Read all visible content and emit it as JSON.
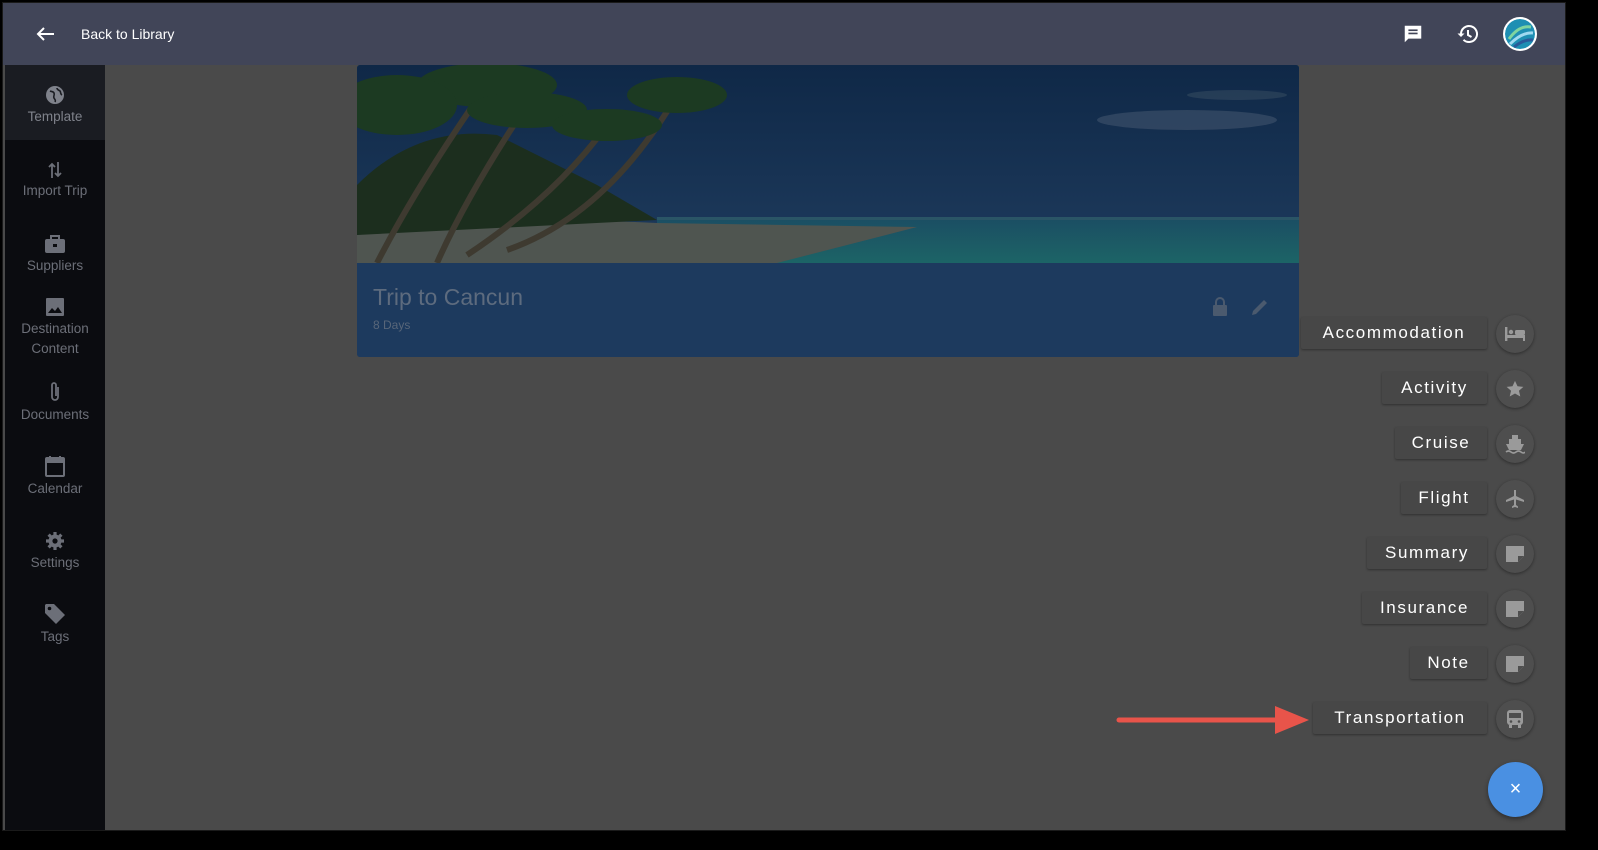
{
  "header": {
    "back_label": "Back to Library",
    "icons": [
      "arrow-back-icon",
      "chat-icon",
      "history-icon",
      "avatar"
    ]
  },
  "sidebar": {
    "items": [
      {
        "label": "Template",
        "icon": "globe-icon",
        "active": true
      },
      {
        "label": "Import Trip",
        "icon": "import-arrows-icon"
      },
      {
        "label": "Suppliers",
        "icon": "briefcase-icon"
      },
      {
        "label": "Destination Content",
        "icon": "image-icon"
      },
      {
        "label": "Documents",
        "icon": "paperclip-icon"
      },
      {
        "label": "Calendar",
        "icon": "calendar-icon"
      },
      {
        "label": "Settings",
        "icon": "gear-icon"
      },
      {
        "label": "Tags",
        "icon": "tag-icon"
      }
    ]
  },
  "trip": {
    "title": "Trip to Cancun",
    "duration": "8 Days"
  },
  "speed_dial": {
    "items": [
      {
        "label": "Accommodation",
        "icon": "bed-icon"
      },
      {
        "label": "Activity",
        "icon": "star-icon"
      },
      {
        "label": "Cruise",
        "icon": "ship-icon"
      },
      {
        "label": "Flight",
        "icon": "airplane-icon"
      },
      {
        "label": "Summary",
        "icon": "note-icon"
      },
      {
        "label": "Insurance",
        "icon": "note-icon"
      },
      {
        "label": "Note",
        "icon": "note-icon"
      },
      {
        "label": "Transportation",
        "icon": "bus-icon"
      }
    ],
    "close_symbol": "×"
  },
  "colors": {
    "topbar": "#414558",
    "sidebar": "#0b0c10",
    "overlay_bg": "#4a4a4a",
    "fab": "#4a90e2",
    "arrow": "#e8544a"
  }
}
